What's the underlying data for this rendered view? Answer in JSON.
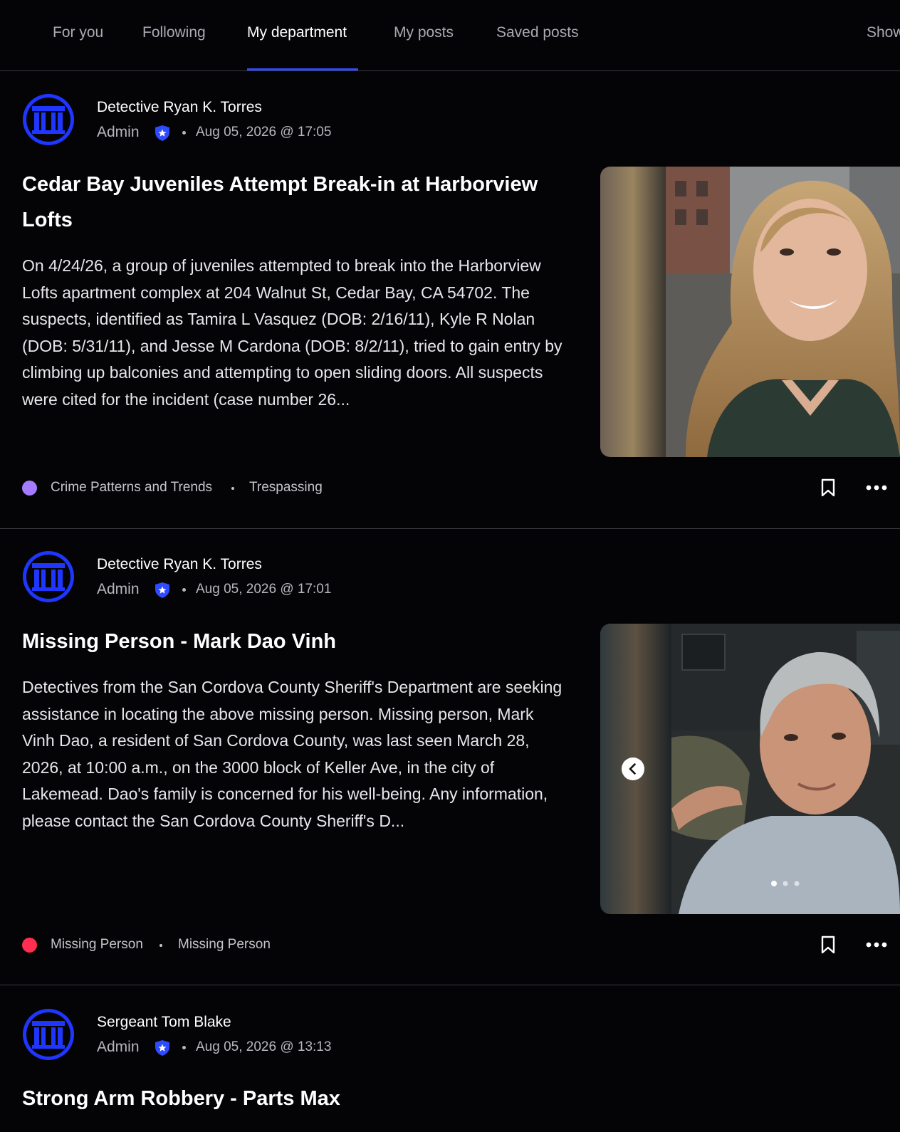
{
  "tabs": [
    {
      "label": "For you"
    },
    {
      "label": "Following"
    },
    {
      "label": "My department",
      "active": true
    },
    {
      "label": "My posts"
    },
    {
      "label": "Saved posts"
    },
    {
      "label": "Show"
    }
  ],
  "colors": {
    "accent": "#2f4bff",
    "background": "#040407",
    "category_crime_patterns": "#a57cff",
    "category_missing_person": "#ff2d4f"
  },
  "posts": [
    {
      "author": "Detective Ryan K. Torres",
      "role": "Admin",
      "timestamp": "Aug 05, 2026 @ 17:05",
      "title": "Cedar Bay Juveniles Attempt Break-in at Harborview Lofts",
      "body": "On 4/24/26, a group of juveniles attempted to break into the Harborview Lofts apartment complex at 204 Walnut St, Cedar Bay, CA 54702. The suspects, identified as Tamira L Vasquez (DOB: 2/16/11), Kyle R Nolan (DOB: 5/31/11), and Jesse M Cardona (DOB: 8/2/11), tried to gain entry by climbing up balconies and attempting to open sliding doors. All suspects were cited for the incident (case number 26...",
      "category": "Crime Patterns and Trends",
      "tag": "Trespassing",
      "icons": [
        "department-logo-icon",
        "verified-shield-icon",
        "bookmark-icon",
        "more-options-icon"
      ]
    },
    {
      "author": "Detective Ryan K. Torres",
      "role": "Admin",
      "timestamp": "Aug 05, 2026 @ 17:01",
      "title": "Missing Person - Mark Dao Vinh",
      "body": "Detectives from the San Cordova County Sheriff's Department are seeking assistance in locating the above missing person. Missing person, Mark Vinh Dao, a resident of San Cordova County, was last seen March 28, 2026, at 10:00 a.m., on the 3000 block of Keller Ave, in the city of Lakemead. Dao's family is concerned for his well-being. Any information, please contact the San Cordova County Sheriff's D...",
      "category": "Missing Person",
      "tag": "Missing Person",
      "icons": [
        "department-logo-icon",
        "verified-shield-icon",
        "chevron-left-icon",
        "bookmark-icon",
        "more-options-icon"
      ]
    },
    {
      "author": "Sergeant Tom Blake",
      "role": "Admin",
      "timestamp": "Aug 05, 2026 @ 13:13",
      "title": "Strong Arm Robbery - Parts Max",
      "icons": [
        "department-logo-icon",
        "verified-shield-icon"
      ]
    }
  ]
}
